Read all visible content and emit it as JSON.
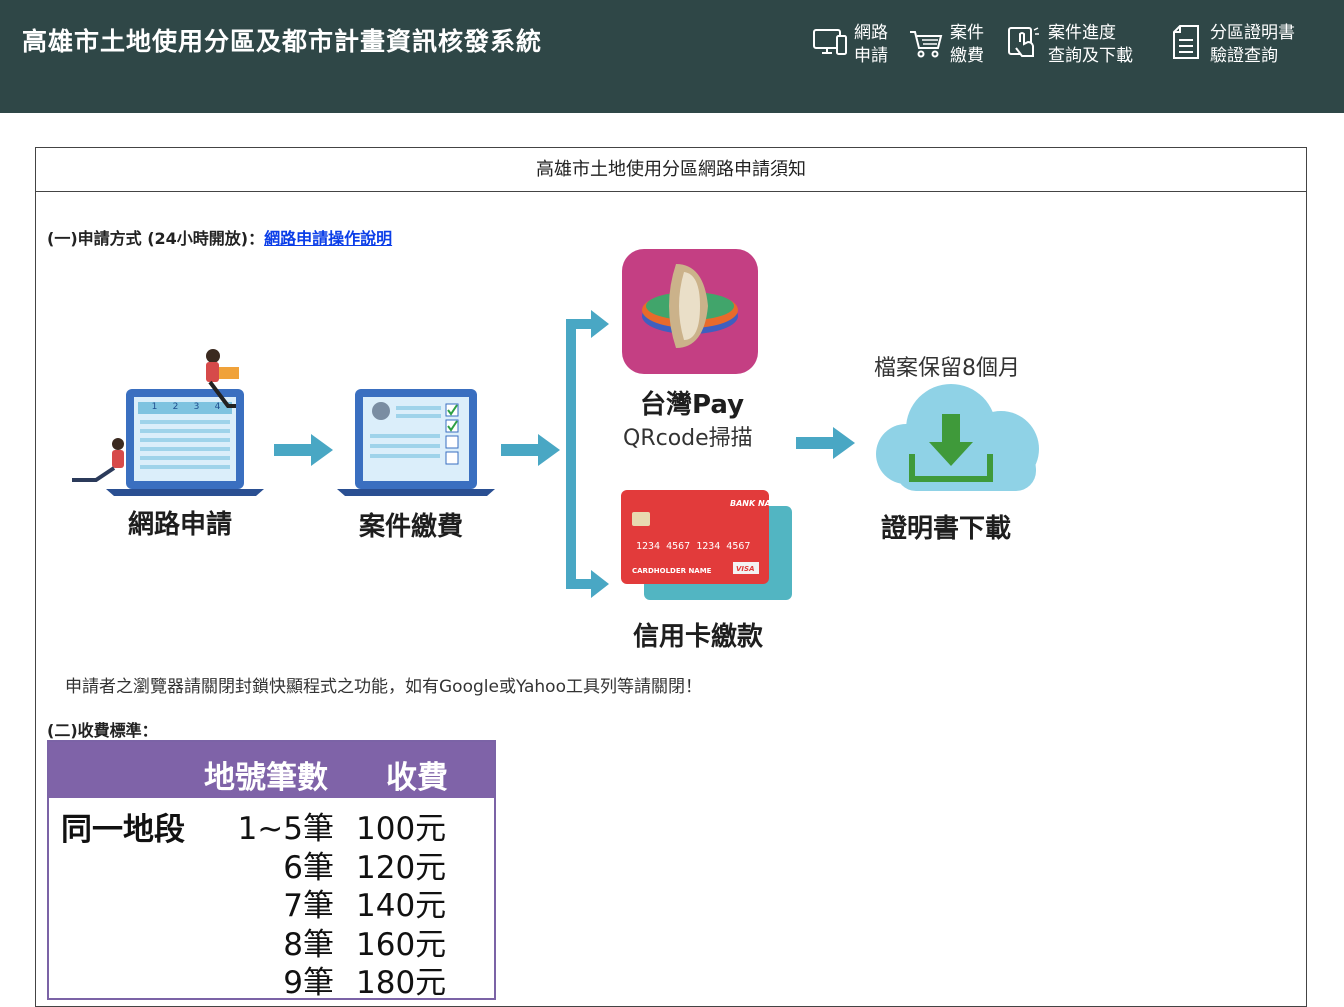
{
  "header": {
    "title": "高雄市土地使用分區及都市計畫資訊核發系統",
    "nav": [
      {
        "line1": "網路",
        "line2": "申請",
        "icon": "devices-icon"
      },
      {
        "line1": "案件",
        "line2": "繳費",
        "icon": "cart-icon"
      },
      {
        "line1": "案件進度",
        "line2": "查詢及下載",
        "icon": "touch-icon"
      },
      {
        "line1": "分區證明書",
        "line2": "驗證查詢",
        "icon": "document-icon"
      }
    ]
  },
  "notice": {
    "heading": "高雄市土地使用分區網路申請須知",
    "section1_label": "(一)申請方式 (24小時開放)：",
    "section1_link": "網路申請操作說明",
    "flow": {
      "step1": "網路申請",
      "step2": "案件繳費",
      "taiwanpay_title": "台灣Pay",
      "taiwanpay_sub": "QRcode掃描",
      "creditcard": "信用卡繳款",
      "retention": "檔案保留8個月",
      "step4": "證明書下載",
      "card_text": {
        "bank_name": "BANK NAME",
        "number": "1234 4567 1234 4567",
        "holder": "CARDHOLDER NAME",
        "brand": "VISA"
      },
      "progress_steps": [
        "1",
        "2",
        "3",
        "4"
      ],
      "colors": {
        "arrow": "#49a7c4",
        "laptop": "#3a6fc0",
        "pay_bg": "#c43f83",
        "card_red": "#e23b3b",
        "card_teal": "#52b5c2",
        "cloud": "#8fd2e6",
        "download": "#3f9a3a"
      }
    },
    "note": "申請者之瀏覽器請關閉封鎖快顯程式之功能，如有Google或Yahoo工具列等請關閉！",
    "section2_label": "(二)收費標準：",
    "fee_table": {
      "header_count": "地號筆數",
      "header_fee": "收費",
      "group": "同一地段",
      "rows": [
        {
          "count": "1~5筆",
          "fee": "100元"
        },
        {
          "count": "6筆",
          "fee": "120元"
        },
        {
          "count": "7筆",
          "fee": "140元"
        },
        {
          "count": "8筆",
          "fee": "160元"
        },
        {
          "count": "9筆",
          "fee": "180元"
        }
      ]
    }
  }
}
